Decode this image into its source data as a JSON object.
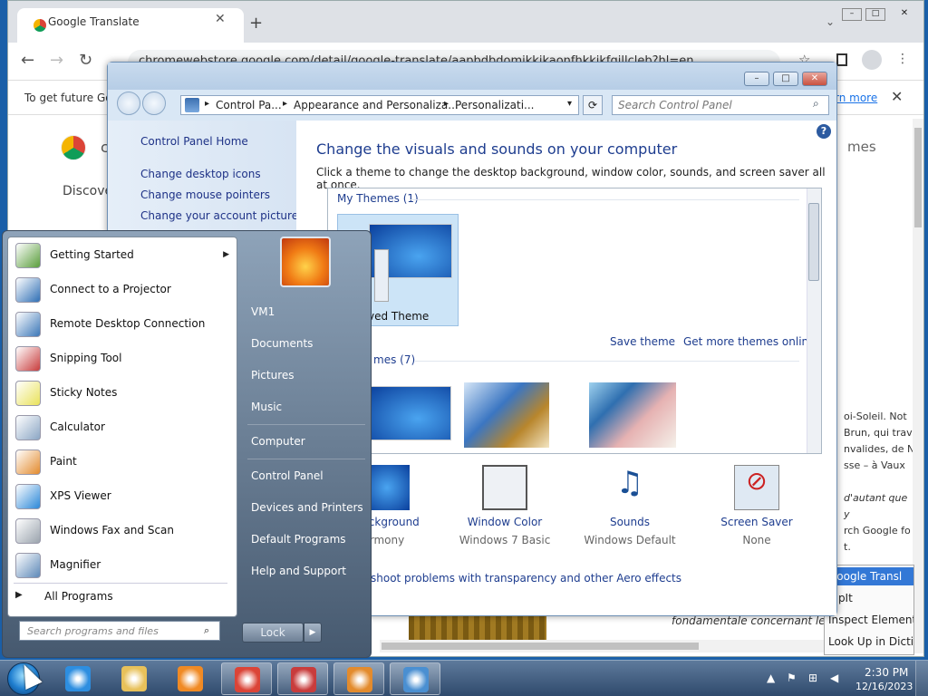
{
  "chrome": {
    "tab_title": "Google Translate",
    "tab_close": "✕",
    "new_tab": "+",
    "tab_chevron": "⌄",
    "back": "←",
    "forward": "→",
    "reload": "↻",
    "url": "chromewebstore.google.com/detail/google-translate/aapbdbdomjkkjkaonfhkkikfgjllcleb?hl=en",
    "infobar_text": "To get future Goo",
    "learn_more": "rn more",
    "infobar_close": "✕",
    "store_name": "ch",
    "discover": "Discover",
    "right_text": "mes",
    "page_fragment_lines": [
      "oi-Soleil. Not",
      "Brun, qui trav",
      "nvalides, de N",
      "sse – à Vaux",
      "",
      "d'autant que",
      "y",
      "rch Google fo",
      "t."
    ],
    "bottom_text": "fondamentale concernant le",
    "context_menu": [
      "Google Transl",
      "nipIt",
      "Inspect Element",
      "Look Up in Dictio"
    ]
  },
  "control_panel": {
    "address": [
      "Control Pa...",
      "Appearance and Personaliza...",
      "Personalizati..."
    ],
    "search_placeholder": "Search Control Panel",
    "refresh": "⟳",
    "left_links": [
      "Control Panel Home",
      "Change desktop icons",
      "Change mouse pointers",
      "Change your account picture"
    ],
    "help": "?",
    "heading": "Change the visuals and sounds on your computer",
    "subheading": "Click a theme to change the desktop background, window color, sounds, and screen saver all at once.",
    "my_themes": "My Themes (1)",
    "unsaved_theme": "ved Theme",
    "save_theme": "Save theme",
    "get_more_themes": "Get more themes online",
    "aero_themes": "mes (7)",
    "bottom": [
      {
        "label": "Background",
        "sub": "rmony"
      },
      {
        "label": "Window Color",
        "sub": "Windows 7 Basic"
      },
      {
        "label": "Sounds",
        "sub": "Windows Default"
      },
      {
        "label": "Screen Saver",
        "sub": "None"
      }
    ],
    "aero_trouble": "shoot problems with transparency and other Aero effects"
  },
  "start_menu": {
    "programs": [
      {
        "label": "Getting Started",
        "icon": "getting-started-icon",
        "color": "#5a9e3c",
        "submenu": true
      },
      {
        "label": "Connect to a Projector",
        "icon": "projector-icon",
        "color": "#2f6fb5"
      },
      {
        "label": "Remote Desktop Connection",
        "icon": "remote-desktop-icon",
        "color": "#3b77b8"
      },
      {
        "label": "Snipping Tool",
        "icon": "scissors-icon",
        "color": "#c83c3c"
      },
      {
        "label": "Sticky Notes",
        "icon": "sticky-notes-icon",
        "color": "#e9e25a"
      },
      {
        "label": "Calculator",
        "icon": "calculator-icon",
        "color": "#8ba6c4"
      },
      {
        "label": "Paint",
        "icon": "paint-icon",
        "color": "#e38b2d"
      },
      {
        "label": "XPS Viewer",
        "icon": "xps-viewer-icon",
        "color": "#2b88d8"
      },
      {
        "label": "Windows Fax and Scan",
        "icon": "fax-icon",
        "color": "#9aa3ad"
      },
      {
        "label": "Magnifier",
        "icon": "magnifier-icon",
        "color": "#5d89b8"
      }
    ],
    "all_programs": "All Programs",
    "search_placeholder": "Search programs and files",
    "right_items": [
      "VM1",
      "Documents",
      "Pictures",
      "Music",
      "Computer",
      "Control Panel",
      "Devices and Printers",
      "Default Programs",
      "Help and Support"
    ],
    "lock": "Lock",
    "lock_arrow": "▶"
  },
  "taskbar": {
    "apps": [
      {
        "name": "ie-icon",
        "color": "#2d8ee0"
      },
      {
        "name": "explorer-icon",
        "color": "#e8c15a"
      },
      {
        "name": "media-player-icon",
        "color": "#f08a24"
      },
      {
        "name": "chrome-icon",
        "color": "#db4437"
      },
      {
        "name": "snipping-tool-icon",
        "color": "#c83c3c"
      },
      {
        "name": "paint-icon",
        "color": "#e38b2d"
      },
      {
        "name": "control-panel-icon",
        "color": "#4a8fd1"
      }
    ],
    "time": "2:30 PM",
    "date": "12/16/2023"
  }
}
